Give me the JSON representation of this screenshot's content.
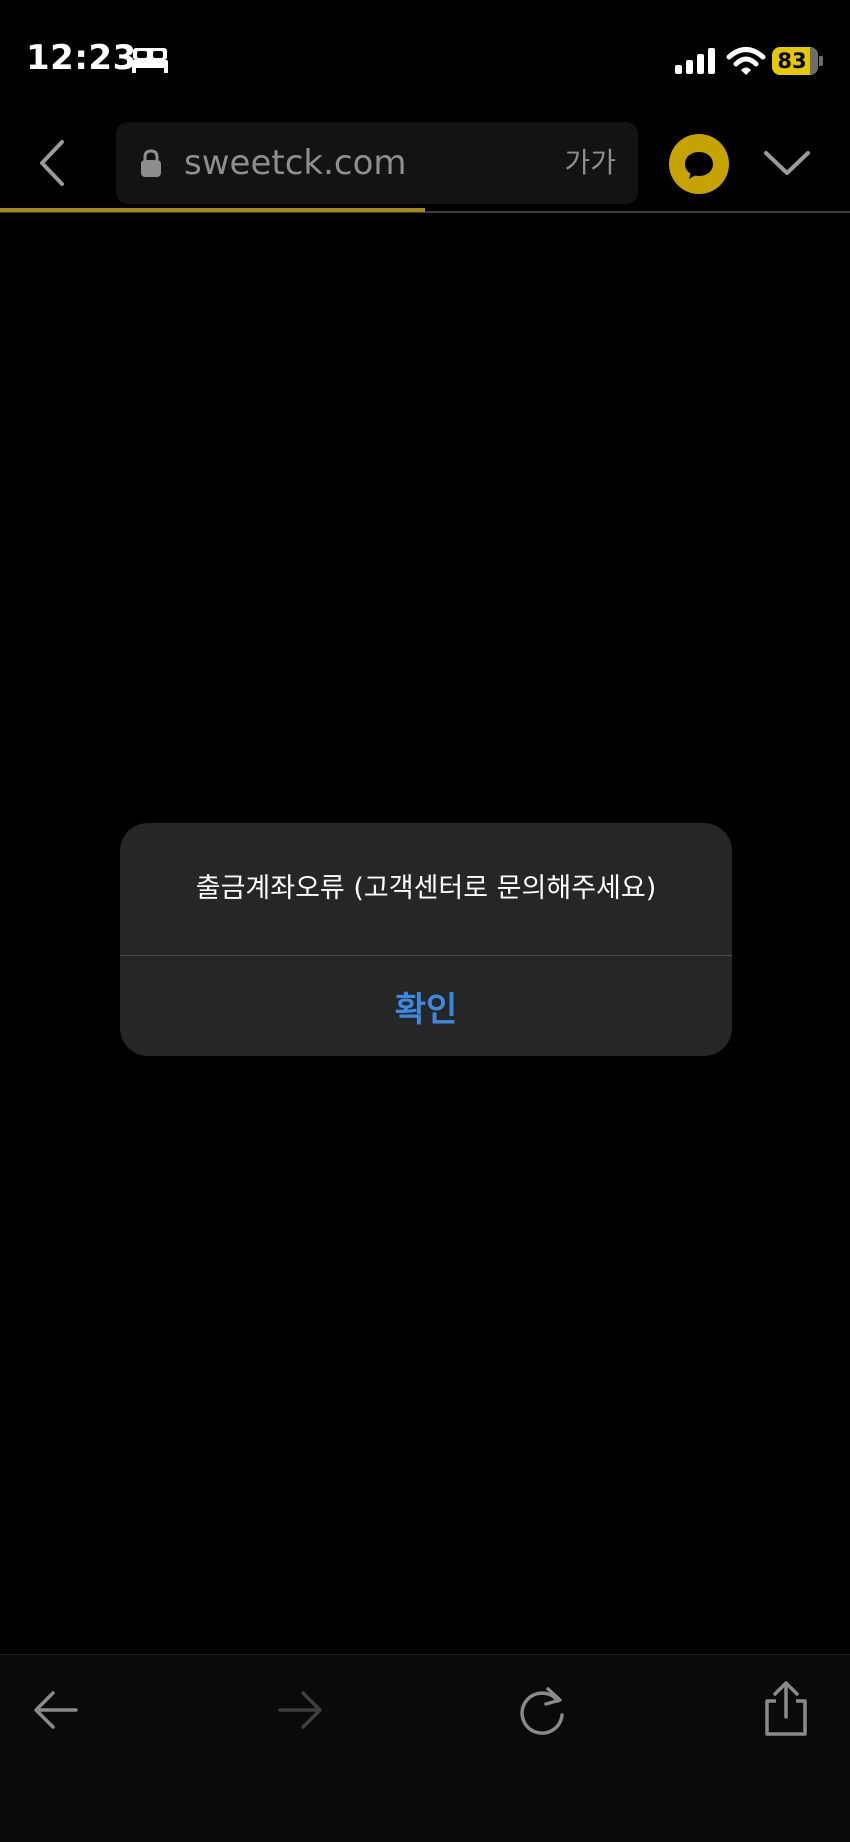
{
  "status_bar": {
    "time": "12:23",
    "battery_percent": "83",
    "icons": [
      "sleep-bed-icon",
      "cellular-signal-icon",
      "wifi-icon",
      "battery-icon"
    ]
  },
  "browser": {
    "url": "sweetck.com",
    "text_size_label": "가가",
    "page_load_progress": 0.5,
    "icons": [
      "back-chevron-icon",
      "lock-icon",
      "chat-bubble-icon",
      "chevron-down-icon"
    ]
  },
  "alert": {
    "message": "출금계좌오류 (고객센터로 문의해주세요)",
    "confirm_label": "확인"
  },
  "bottom_toolbar": {
    "icons": [
      "arrow-left-icon",
      "arrow-right-icon",
      "reload-icon",
      "share-icon"
    ]
  },
  "colors": {
    "background": "#000000",
    "accent_gold": "#c7a300",
    "progress_gold": "#a88a15",
    "battery_yellow": "#e6c800",
    "alert_bg": "#262626",
    "alert_button_blue": "#3d89e0",
    "url_text_gray": "#8e8e8e"
  }
}
